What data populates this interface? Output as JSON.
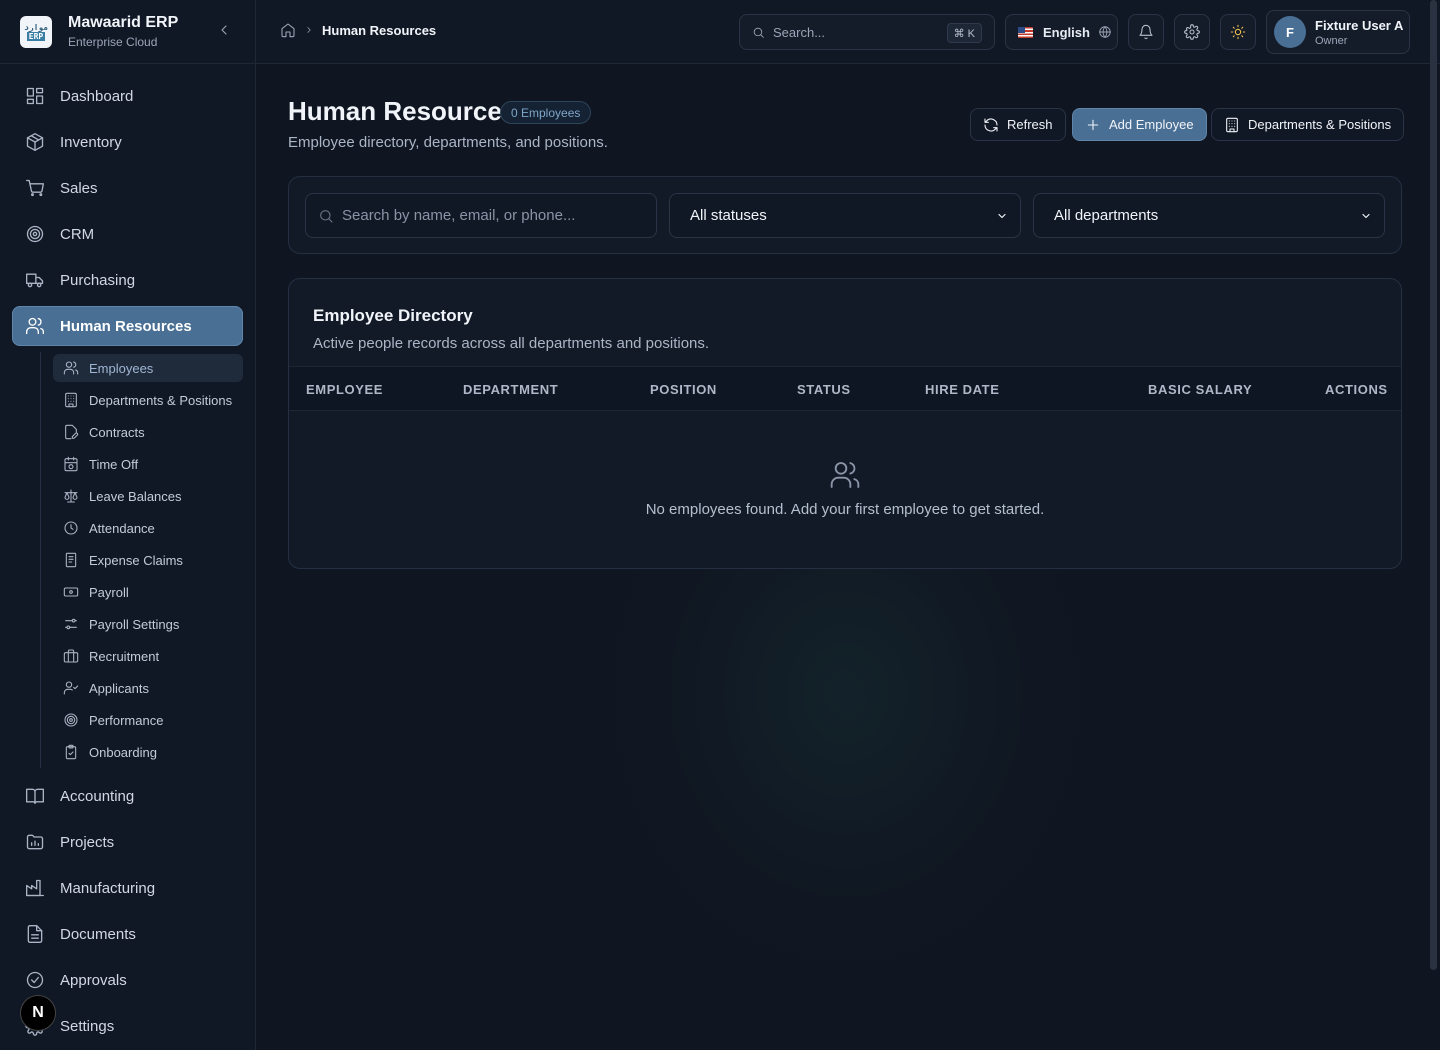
{
  "brand": {
    "name": "Mawaarid ERP",
    "subtitle": "Enterprise Cloud",
    "logo_top": "موارد",
    "logo_bottom": "ERP"
  },
  "sidebar": {
    "items": [
      {
        "label": "Dashboard",
        "icon": "dashboard-icon"
      },
      {
        "label": "Inventory",
        "icon": "package-icon"
      },
      {
        "label": "Sales",
        "icon": "cart-icon"
      },
      {
        "label": "CRM",
        "icon": "target-icon"
      },
      {
        "label": "Purchasing",
        "icon": "truck-icon"
      },
      {
        "label": "Human Resources",
        "icon": "users-icon",
        "active": true
      },
      {
        "label": "Accounting",
        "icon": "book-icon"
      },
      {
        "label": "Projects",
        "icon": "folder-icon"
      },
      {
        "label": "Manufacturing",
        "icon": "factory-icon"
      },
      {
        "label": "Documents",
        "icon": "document-icon"
      },
      {
        "label": "Approvals",
        "icon": "check-circle-icon"
      },
      {
        "label": "Settings",
        "icon": "gear-icon"
      }
    ],
    "sub_items": [
      {
        "label": "Employees",
        "active": true
      },
      {
        "label": "Departments & Positions"
      },
      {
        "label": "Contracts"
      },
      {
        "label": "Time Off"
      },
      {
        "label": "Leave Balances"
      },
      {
        "label": "Attendance"
      },
      {
        "label": "Expense Claims"
      },
      {
        "label": "Payroll"
      },
      {
        "label": "Payroll Settings"
      },
      {
        "label": "Recruitment"
      },
      {
        "label": "Applicants"
      },
      {
        "label": "Performance"
      },
      {
        "label": "Onboarding"
      }
    ],
    "dev_badge": "N"
  },
  "header": {
    "breadcrumb": "Human Resources",
    "search_placeholder": "Search...",
    "shortcut": "⌘ K",
    "language": "English",
    "user": {
      "initial": "F",
      "name": "Fixture User A",
      "role": "Owner"
    }
  },
  "page": {
    "title": "Human Resources",
    "count_badge": "0 Employees",
    "subtitle": "Employee directory, departments, and positions.",
    "actions": {
      "refresh": "Refresh",
      "add": "Add Employee",
      "departments": "Departments & Positions"
    },
    "filters": {
      "search_placeholder": "Search by name, email, or phone...",
      "status": "All statuses",
      "department": "All departments"
    },
    "directory": {
      "title": "Employee Directory",
      "subtitle": "Active people records across all departments and positions.",
      "columns": [
        "EMPLOYEE",
        "DEPARTMENT",
        "POSITION",
        "STATUS",
        "HIRE DATE",
        "BASIC SALARY",
        "ACTIONS"
      ],
      "empty_message": "No employees found. Add your first employee to get started."
    }
  },
  "colors": {
    "accent": "#4a6f94",
    "background": "#0f1521",
    "sidebar": "#111825"
  }
}
